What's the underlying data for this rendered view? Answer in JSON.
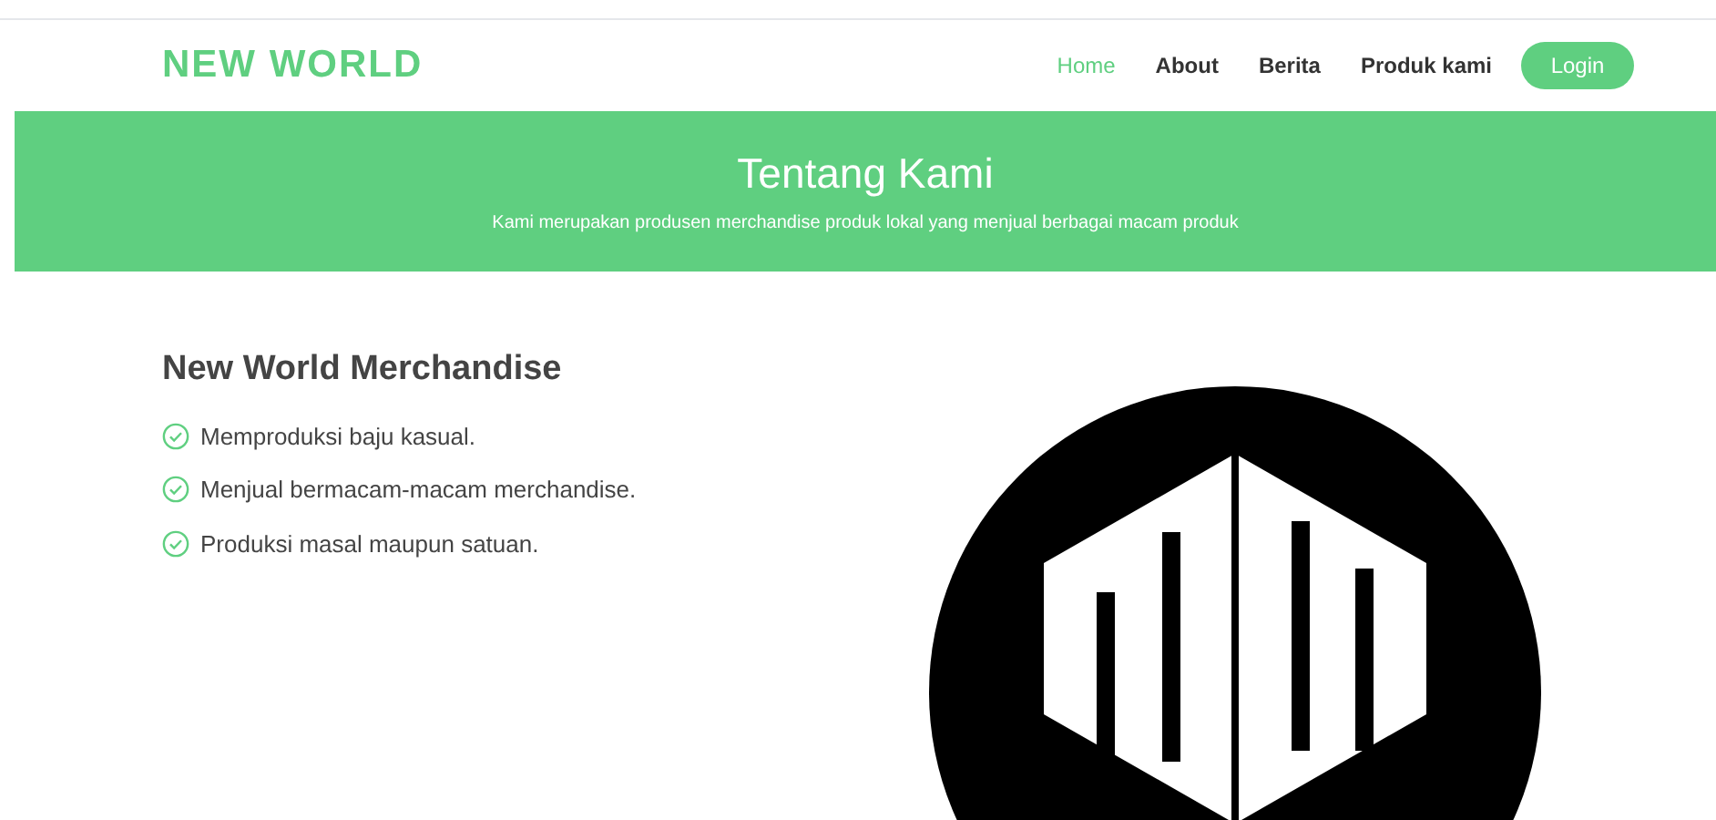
{
  "brand": "NEW WORLD",
  "nav": [
    {
      "label": "Home",
      "selected": true
    },
    {
      "label": "About",
      "selected": false
    },
    {
      "label": "Berita",
      "selected": false
    },
    {
      "label": "Produk kami",
      "selected": false
    }
  ],
  "login": "Login",
  "hero": {
    "title": "Tentang Kami",
    "subtitle": "Kami merupakan produsen merchandise produk lokal yang menjual berbagai macam produk"
  },
  "section": {
    "heading": "New World Merchandise",
    "points": [
      "Memproduksi baju kasual.",
      "Menjual bermacam-macam merchandise.",
      "Produksi masal maupun satuan."
    ]
  }
}
